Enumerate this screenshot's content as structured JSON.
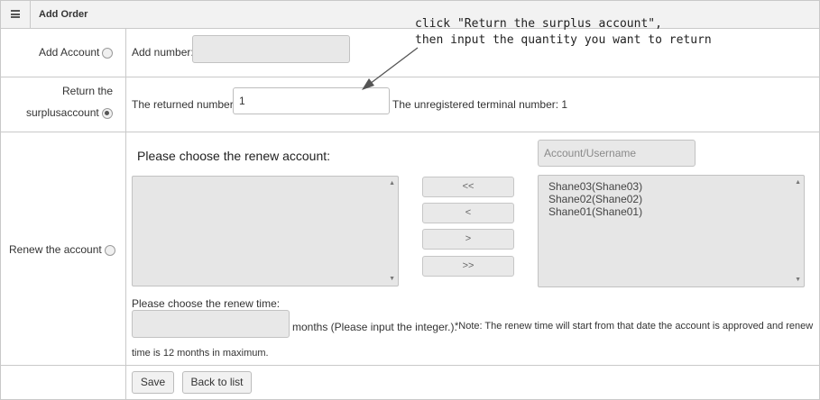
{
  "header": {
    "title": "Add Order",
    "menu_icon": "menu-icon"
  },
  "add_account": {
    "label": "Add Account",
    "number_label": "Add number:",
    "number_value": ""
  },
  "return_surplus": {
    "label_line1": "Return the",
    "label_line2": "surplusaccount",
    "returned_label": "The returned number:",
    "returned_value": "1",
    "unregistered_text": "The unregistered terminal number: 1"
  },
  "renew": {
    "label": "Renew the account",
    "choose_title": "Please choose the renew account:",
    "search_placeholder": "Account/Username",
    "move_buttons": [
      "<<",
      "<",
      ">",
      ">>"
    ],
    "selected_accounts": [
      "Shane03(Shane03)",
      "Shane02(Shane02)",
      "Shane01(Shane01)"
    ],
    "time_label": "Please choose the renew time:",
    "months_text": "months (Please input the integer.).",
    "note_text": "*Note: The renew time will start from that date the account is approved and renew",
    "note_text_2": "time is 12 months in maximum."
  },
  "actions": {
    "save": "Save",
    "back": "Back to list"
  },
  "annotation": {
    "line1": "click \"Return the surplus account\",",
    "line2": "then input the quantity you want to return"
  },
  "colors": {
    "border": "#c9c9c9",
    "header_bg": "#f2f2f2",
    "input_bg": "#e8e8e8"
  }
}
